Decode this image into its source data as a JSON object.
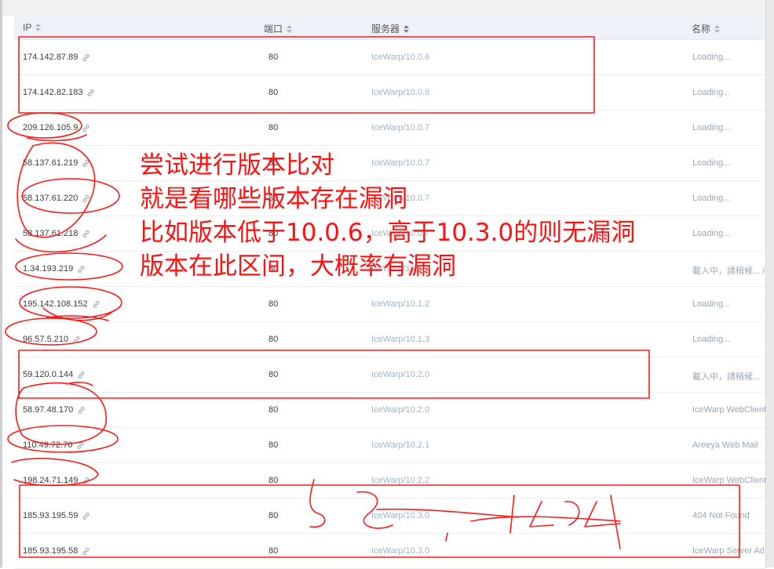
{
  "table": {
    "columns": [
      {
        "label": "IP"
      },
      {
        "label": "端口"
      },
      {
        "label": "服务器"
      },
      {
        "label": "名称"
      }
    ],
    "rows": [
      {
        "ip": "174.142.87.89",
        "port": "80",
        "server": "IceWarp/10.0.6",
        "name": "Loading..."
      },
      {
        "ip": "174.142.82.183",
        "port": "80",
        "server": "IceWarp/10.0.6",
        "name": "Loading..."
      },
      {
        "ip": "209.126.105.9",
        "port": "80",
        "server": "IceWarp/10.0.7",
        "name": "Loading..."
      },
      {
        "ip": "58.137.61.219",
        "port": "80",
        "server": "IceWarp/10.0.7",
        "name": "Loading..."
      },
      {
        "ip": "58.137.61.220",
        "port": "80",
        "server": "IceWarp/10.0.7",
        "name": "Loading..."
      },
      {
        "ip": "58.137.61.218",
        "port": "80",
        "server": "IceWarp/10.0.7",
        "name": "Loading..."
      },
      {
        "ip": "1.34.193.219",
        "port": "80",
        "server": "IceWarp/10.1.1",
        "name": "載入中，請稍候... /"
      },
      {
        "ip": "195.142.108.152",
        "port": "80",
        "server": "IceWarp/10.1.2",
        "name": "Loading..."
      },
      {
        "ip": "96.57.5.210",
        "port": "80",
        "server": "IceWarp/10.1.3",
        "name": "Loading..."
      },
      {
        "ip": "59.120.0.144",
        "port": "80",
        "server": "IceWarp/10.2.0",
        "name": "載入中，請稍候..."
      },
      {
        "ip": "58.97.48.170",
        "port": "80",
        "server": "IceWarp/10.2.0",
        "name": "IceWarp WebClient"
      },
      {
        "ip": "110.49.72.70",
        "port": "80",
        "server": "IceWarp/10.2.1",
        "name": "Areeya Web Mail"
      },
      {
        "ip": "198.24.71.149",
        "port": "80",
        "server": "IceWarp/10.2.2",
        "name": "IceWarp WebClient"
      },
      {
        "ip": "185.93.195.59",
        "port": "80",
        "server": "IceWarp/10.3.0",
        "name": "404 Not Found"
      },
      {
        "ip": "185.93.195.58",
        "port": "80",
        "server": "IceWarp/10.3.0",
        "name": "IceWarp Server Ad"
      }
    ]
  },
  "annotation": {
    "lines": [
      "尝试进行版本比对",
      "就是看哪些版本存在漏洞",
      "比如版本低于10.0.6，高于10.3.0的则无漏洞",
      "版本在此区间，大概率有漏洞"
    ],
    "color": "#ff1111"
  },
  "icons": {
    "sort": "sort-icon",
    "link": "link-icon"
  }
}
